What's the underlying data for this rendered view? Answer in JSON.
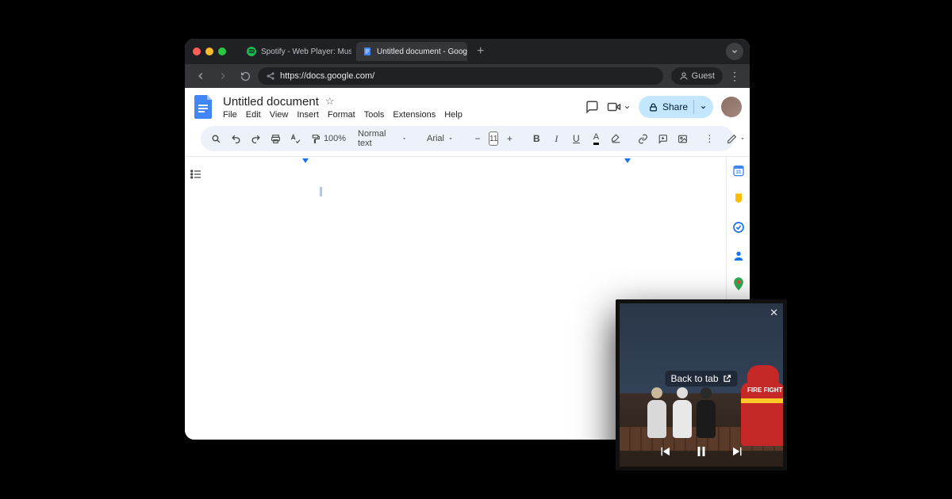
{
  "browser": {
    "tabs": [
      {
        "title": "Spotify - Web Player: Music f",
        "icon": "spotify"
      },
      {
        "title": "Untitled document - Google D",
        "icon": "docs"
      }
    ],
    "url": "https://docs.google.com/",
    "guest_label": "Guest"
  },
  "docs": {
    "title": "Untitled document",
    "menus": [
      "File",
      "Edit",
      "View",
      "Insert",
      "Format",
      "Tools",
      "Extensions",
      "Help"
    ],
    "share_label": "Share",
    "toolbar": {
      "zoom": "100%",
      "style": "Normal text",
      "font": "Arial",
      "font_size": "11"
    }
  },
  "pip": {
    "back_label": "Back to tab",
    "fire_text": "FIRE\nFIGHTE"
  }
}
